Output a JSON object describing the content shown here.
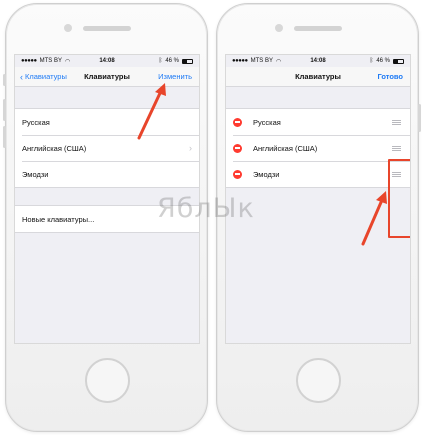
{
  "watermark": "ЯблЫк",
  "accent_color": "#1f7bf5",
  "annotation_color": "#e8452b",
  "left_screen": {
    "status": {
      "carrier": "MTS BY",
      "time": "14:08",
      "battery": "46 %"
    },
    "nav": {
      "back_label": "Клавиатуры",
      "title": "Клавиатуры",
      "action_label": "Изменить"
    },
    "keyboards": [
      {
        "label": "Русская"
      },
      {
        "label": "Английская (США)"
      },
      {
        "label": "Эмодзи"
      }
    ],
    "add_keyboard_label": "Новые клавиатуры..."
  },
  "right_screen": {
    "status": {
      "carrier": "MTS BY",
      "time": "14:08",
      "battery": "46 %"
    },
    "nav": {
      "title": "Клавиатуры",
      "action_label": "Готово"
    },
    "keyboards": [
      {
        "label": "Русская"
      },
      {
        "label": "Английская (США)"
      },
      {
        "label": "Эмодзи"
      }
    ]
  }
}
